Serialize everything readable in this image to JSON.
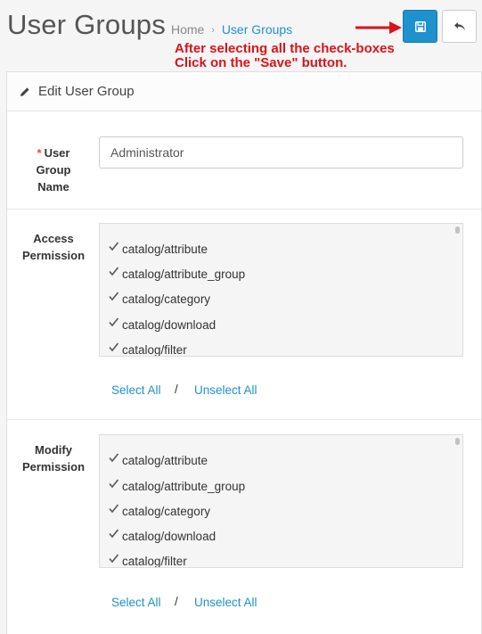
{
  "header": {
    "title": "User Groups",
    "breadcrumb": [
      {
        "label": "Home"
      },
      {
        "label": "User Groups"
      }
    ],
    "breadcrumb_separator": "›"
  },
  "annotation": {
    "line1": "After selecting all the check-boxes",
    "line2": "Click on the \"Save\" button.",
    "color": "#d9141b"
  },
  "toolbar": {
    "save_icon": "floppy-disk-icon",
    "back_icon": "reply-arrow-icon",
    "accent": "#1e91cf"
  },
  "panel": {
    "title": "Edit User Group",
    "icon": "pencil-icon"
  },
  "form": {
    "group_name": {
      "label_line1": "User",
      "label_line2": "Group",
      "label_line3": "Name",
      "required_mark": "*",
      "value": "Administrator"
    },
    "access": {
      "label_line1": "Access",
      "label_line2": "Permission",
      "items": [
        {
          "label": "catalog/attribute",
          "checked": true
        },
        {
          "label": "catalog/attribute_group",
          "checked": true
        },
        {
          "label": "catalog/category",
          "checked": true
        },
        {
          "label": "catalog/download",
          "checked": true
        },
        {
          "label": "catalog/filter",
          "checked": true
        }
      ],
      "select_all": "Select All",
      "separator": "/",
      "unselect_all": "Unselect All"
    },
    "modify": {
      "label_line1": "Modify",
      "label_line2": "Permission",
      "items": [
        {
          "label": "catalog/attribute",
          "checked": true
        },
        {
          "label": "catalog/attribute_group",
          "checked": true
        },
        {
          "label": "catalog/category",
          "checked": true
        },
        {
          "label": "catalog/download",
          "checked": true
        },
        {
          "label": "catalog/filter",
          "checked": true
        }
      ],
      "select_all": "Select All",
      "separator": "/",
      "unselect_all": "Unselect All"
    }
  }
}
